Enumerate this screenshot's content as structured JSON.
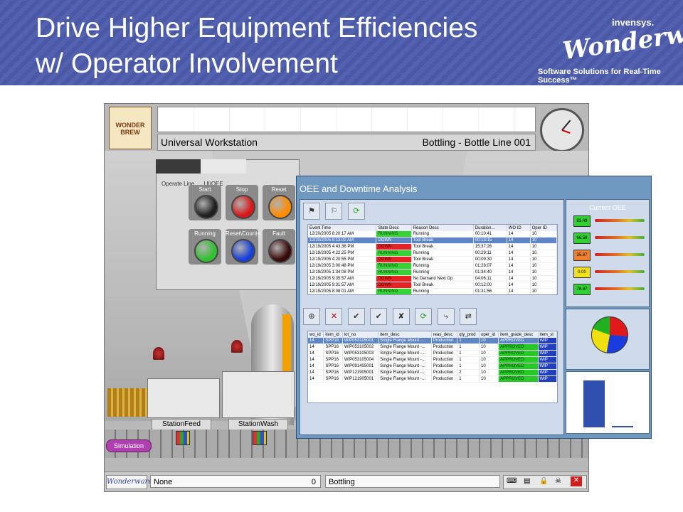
{
  "slide": {
    "title_line1": "Drive Higher Equipment Efficiencies",
    "title_line2": "w/ Operator Involvement",
    "brand_company": "invensys.",
    "brand_logo": "Wonderware",
    "brand_tagline": "Software Solutions for Real-Time Success™"
  },
  "workstation": {
    "title": "Universal Workstation",
    "line": "Bottling - Bottle Line 001",
    "logo_text": "WONDER BREW"
  },
  "control_panel": {
    "operate_line": "Operate Line",
    "oee_label": "UI/OEE",
    "buttons": [
      {
        "label": "Start",
        "color": "#202020"
      },
      {
        "label": "Stop",
        "color": "#d81818"
      },
      {
        "label": "Reset",
        "color": "#ff8c00"
      },
      {
        "label": "Running",
        "color": "#30c030"
      },
      {
        "label": "Reset\\Counts",
        "color": "#1840d8"
      },
      {
        "label": "Fault",
        "color": "#3a0a0a"
      }
    ]
  },
  "stations": {
    "feed_label": "StationFeed",
    "wash_label": "StationWash",
    "simulation_button": "Simulation"
  },
  "statusbar": {
    "logo": "Wonderware",
    "user": "None",
    "count": "0",
    "area": "Bottling"
  },
  "oee_window": {
    "title": "OEE and Downtime Analysis",
    "event_grid": {
      "headers": [
        "Event Time",
        "State Desc",
        "Reason Desc",
        "Duration...",
        "WO ID",
        "Oper ID"
      ],
      "rows": [
        [
          "12/20/2005 8:20:17 AM",
          "RUNNING",
          "Running",
          "00:10:41",
          "14",
          "10"
        ],
        [
          "12/20/2005 8:13:02 AM",
          "DOWN",
          "Tool Break",
          "00:13:15",
          "14",
          "10"
        ],
        [
          "12/19/2005 4:43:36 PM",
          "DOWN",
          "Tool Break",
          "15:37:26",
          "14",
          "10"
        ],
        [
          "12/19/2005 4:22:25 PM",
          "RUNNING",
          "Running",
          "00:29:11",
          "14",
          "10"
        ],
        [
          "12/19/2005 4:20:55 PM",
          "DOWN",
          "Tool Break",
          "00:09:30",
          "14",
          "10"
        ],
        [
          "12/19/2005 3:00:48 PM",
          "RUNNING",
          "Running",
          "01:28:07",
          "14",
          "10"
        ],
        [
          "12/19/2005 1:34:08 PM",
          "RUNNING",
          "Running",
          "01:34:40",
          "14",
          "10"
        ],
        [
          "12/19/2005 9:35:57 AM",
          "DOWN",
          "No Demand Next Op",
          "04:06:11",
          "14",
          "10"
        ],
        [
          "12/19/2005 9:31:57 AM",
          "DOWN",
          "Tool Break",
          "00:12:00",
          "14",
          "10"
        ],
        [
          "12/19/2005 8:08:01 AM",
          "RUNNING",
          "Running",
          "01:31:56",
          "14",
          "10"
        ]
      ]
    },
    "item_grid": {
      "headers": [
        "wo_id",
        "item_id",
        "lot_no",
        "item_desc",
        "reas_desc",
        "qty_prod",
        "oper_id",
        "item_grade_desc",
        "item_st"
      ],
      "rows": [
        [
          "14",
          "SPP16",
          "WIP053105001",
          "Single Flange Mount -...",
          "Production",
          "1",
          "10",
          "APPROVED",
          "WIP"
        ],
        [
          "14",
          "SPP16",
          "WIP053105002",
          "Single Flange Mount -...",
          "Production",
          "1",
          "10",
          "APPROVED",
          "WIP"
        ],
        [
          "14",
          "SPP16",
          "WIP053105003",
          "Single Flange Mount -...",
          "Production",
          "1",
          "10",
          "APPROVED",
          "WIP"
        ],
        [
          "14",
          "SPP16",
          "WIP053105004",
          "Single Flange Mount -...",
          "Production",
          "1",
          "10",
          "APPROVED",
          "WIP"
        ],
        [
          "14",
          "SPP16",
          "WIP091405001",
          "Single Flange Mount -...",
          "Production",
          "1",
          "10",
          "APPROVED",
          "WIP"
        ],
        [
          "14",
          "SPP16",
          "WIP121905001",
          "Single Flange Mount -...",
          "Production",
          "2",
          "10",
          "APPROVED",
          "WIP"
        ],
        [
          "14",
          "SPP16",
          "WIP121905001",
          "Single Flange Mount -...",
          "Production",
          "1",
          "10",
          "APPROVED",
          "WIP"
        ]
      ]
    },
    "current_oee": {
      "title": "Current OEE",
      "gauges": [
        {
          "value": "83.49",
          "color": "#30d030"
        },
        {
          "value": "66.58",
          "color": "#30d030"
        },
        {
          "value": "35.67",
          "color": "#f08030"
        },
        {
          "value": "0.00",
          "color": "#f0e020"
        },
        {
          "value": "78.87",
          "color": "#30d030"
        }
      ]
    }
  }
}
